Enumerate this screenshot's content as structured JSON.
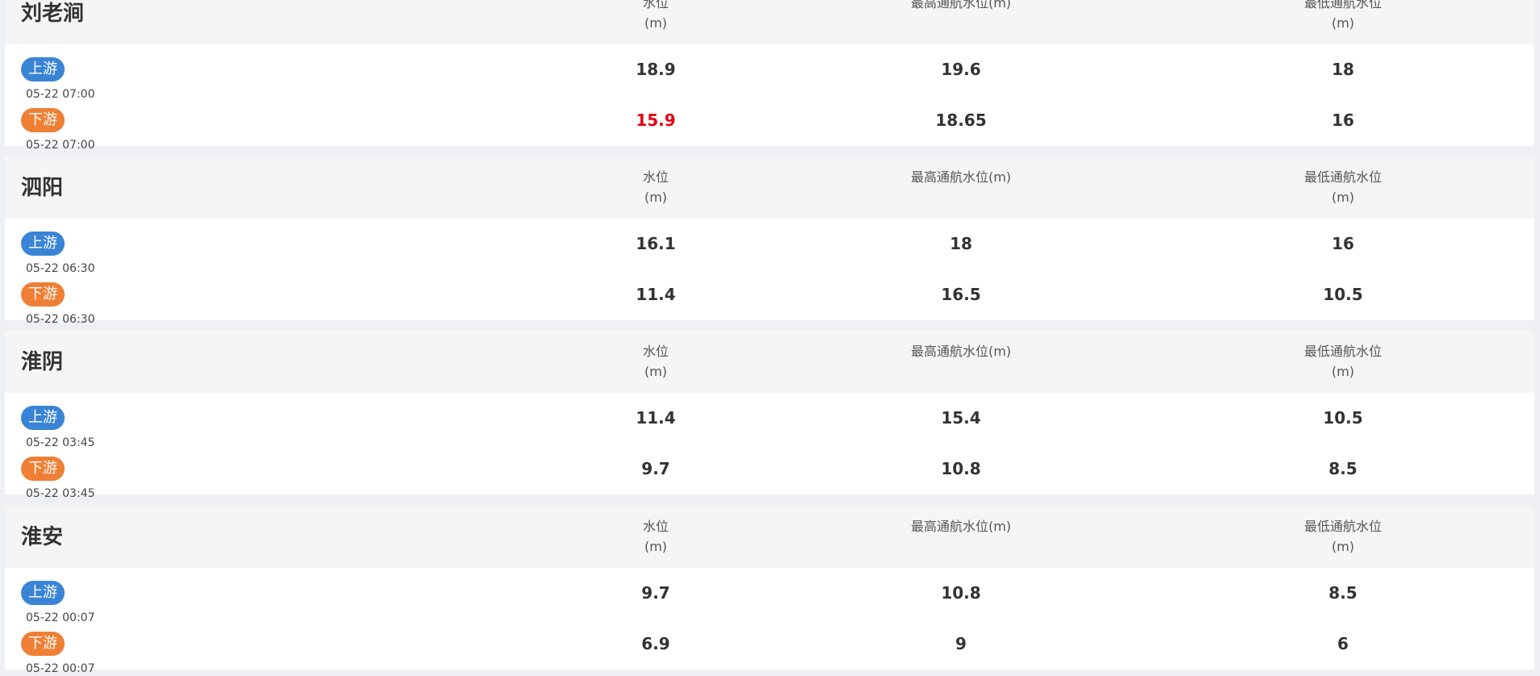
{
  "headers": {
    "level": [
      "水位",
      "(m)"
    ],
    "max": [
      "最高通航水位(m)"
    ],
    "min": [
      "最低通航水位",
      "(m)"
    ]
  },
  "labels": {
    "up": "上游",
    "down": "下游"
  },
  "colors": {
    "up": "#3a84d6",
    "down": "#ef7f35",
    "alert": "#e60012"
  },
  "stations": [
    {
      "name": "刘老涧",
      "up": {
        "time": "05-22 07:00",
        "level": "18.9",
        "max": "19.6",
        "min": "18"
      },
      "down": {
        "time": "05-22 07:00",
        "level": "15.9",
        "max": "18.65",
        "min": "16",
        "alert": true
      }
    },
    {
      "name": "泗阳",
      "up": {
        "time": "05-22 06:30",
        "level": "16.1",
        "max": "18",
        "min": "16"
      },
      "down": {
        "time": "05-22 06:30",
        "level": "11.4",
        "max": "16.5",
        "min": "10.5"
      }
    },
    {
      "name": "淮阴",
      "up": {
        "time": "05-22 03:45",
        "level": "11.4",
        "max": "15.4",
        "min": "10.5"
      },
      "down": {
        "time": "05-22 03:45",
        "level": "9.7",
        "max": "10.8",
        "min": "8.5"
      }
    },
    {
      "name": "淮安",
      "up": {
        "time": "05-22 00:07",
        "level": "9.7",
        "max": "10.8",
        "min": "8.5"
      },
      "down": {
        "time": "05-22 00:07",
        "level": "6.9",
        "max": "9",
        "min": "6"
      }
    }
  ]
}
